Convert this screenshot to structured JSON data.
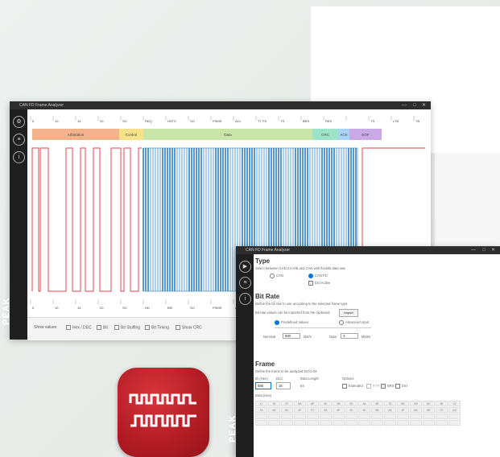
{
  "window1": {
    "title": "CAN FD Frame Analyzer",
    "brand": "PEAK",
    "ruler_top": [
      "0",
      "10",
      "15",
      "20",
      "SO",
      "REQ",
      "HSTS",
      "SO",
      "FRMS",
      "ACL",
      "TT FS",
      "TS",
      "BRS",
      "RES",
      "",
      "TS",
      "LTB",
      "TB"
    ],
    "ruler_bottom": [
      "0",
      "10",
      "15",
      "20",
      "SO",
      "HD",
      "BSI",
      "SO",
      "FRMS",
      "ACL",
      "TT FS",
      "TS",
      "BRS",
      "RES",
      "",
      "",
      "",
      ""
    ],
    "segments": [
      {
        "label": "Arbitration",
        "color": "#f2b38c"
      },
      {
        "label": "Control",
        "color": "#f7e28a"
      },
      {
        "label": "Data",
        "color": "#c9e6a8"
      },
      {
        "label": "CRC",
        "color": "#9fe3c8"
      },
      {
        "label": "ACK",
        "color": "#a9d4f5"
      },
      {
        "label": "EOF",
        "color": "#c9a9e6"
      }
    ],
    "options": {
      "label": "Show values",
      "items": [
        "Hex / DEC",
        "Bit",
        "Bit Stuffing",
        "Bit Timing",
        "Show CRC"
      ]
    }
  },
  "window2": {
    "title": "CAN FD Frame Analyzer",
    "brand": "PEAK",
    "type": {
      "heading": "Type",
      "desc": "Select between CAN 2.0 A/B and CAN with flexible data rate",
      "options": [
        "CAN",
        "CAN FD"
      ],
      "esi_label": "ESI Active"
    },
    "bitrate": {
      "heading": "Bit Rate",
      "desc": "Define the bit rate to use according to the selected frame type",
      "import_label": "Bit rate values can be imported from the clipboard",
      "import_button": "Import",
      "modes": [
        "Predefined Values",
        "Advanced Input"
      ],
      "nominal_label": "Nominal",
      "nominal_value": "500",
      "nominal_unit": "kbit/s",
      "data_label": "Data",
      "data_value": "4",
      "data_unit": "Mbit/s"
    },
    "frame": {
      "heading": "Frame",
      "desc": "Define the frame to be analyzed bit for bit",
      "id_label": "ID (Hex)",
      "id_value": "555",
      "dlc_label": "DLC",
      "dlc_value": "15",
      "length_label": "Data Length",
      "length_value": "64",
      "options_label": "Options",
      "options": [
        "Extended",
        "RTR",
        "BRS",
        "ESI"
      ],
      "data_label": "Data (Hex)",
      "data_row1": [
        "17",
        "7E",
        "87",
        "5A",
        "8F",
        "4C",
        "2B",
        "9C",
        "1A",
        "4E",
        "7D",
        "5B",
        "A9",
        "6C",
        "3E",
        "12"
      ],
      "data_row2": [
        "7A",
        "AE",
        "8C",
        "4F",
        "E7",
        "3A",
        "9F",
        "4C",
        "1C",
        "5B",
        "2A",
        "3F",
        "8A",
        "6E",
        "07",
        "A2"
      ]
    }
  }
}
